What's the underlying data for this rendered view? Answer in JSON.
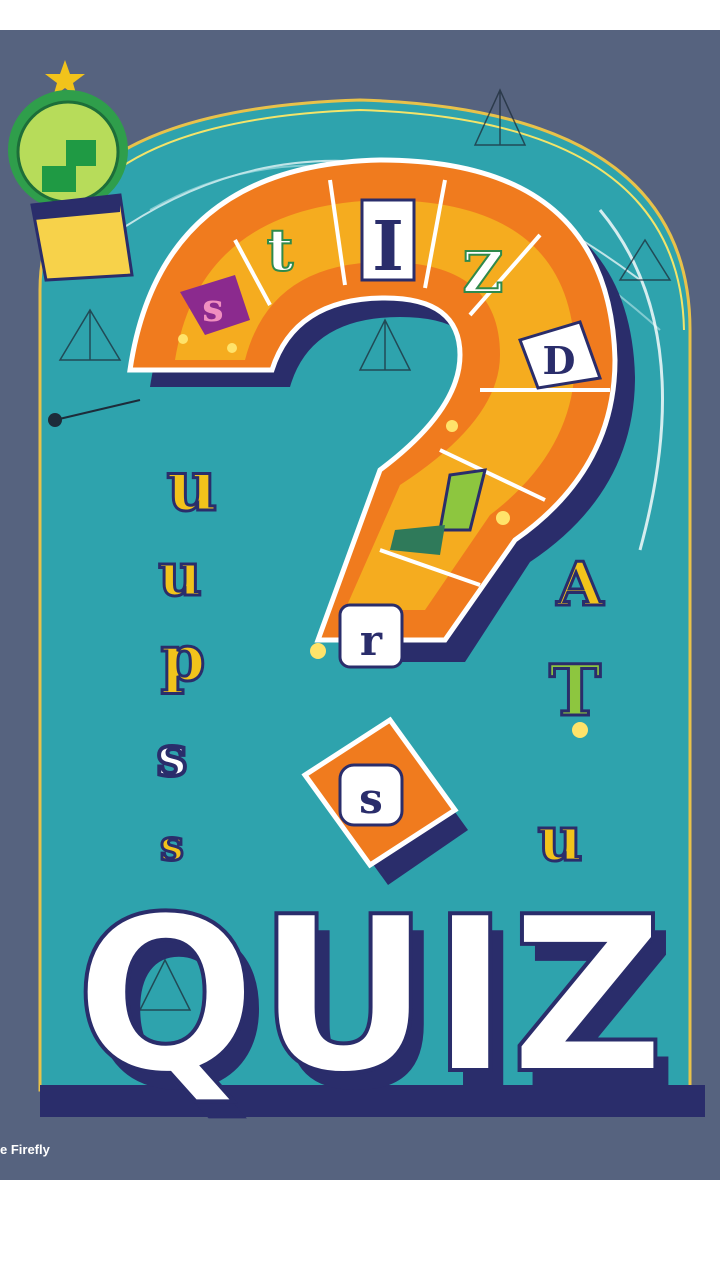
{
  "poster": {
    "title": "QUIZ",
    "watermark": "e Firefly",
    "tile_letters": [
      "s",
      "t",
      "I",
      "Z",
      "D",
      "r",
      "s"
    ],
    "side_letters_left": [
      "u",
      "u",
      "p",
      "s",
      "s"
    ],
    "side_letters_right": [
      "A",
      "T",
      "u"
    ]
  },
  "colors": {
    "frame": "#56637f",
    "panel": "#2ea3ad",
    "question_mark": "#f07b1e",
    "navy_shadow": "#2a2d6b",
    "yellow": "#f2c31b",
    "badge_green": "#8dc63f"
  },
  "icons": [
    "star-icon",
    "puzzle-icon",
    "question-mark-illustration"
  ]
}
